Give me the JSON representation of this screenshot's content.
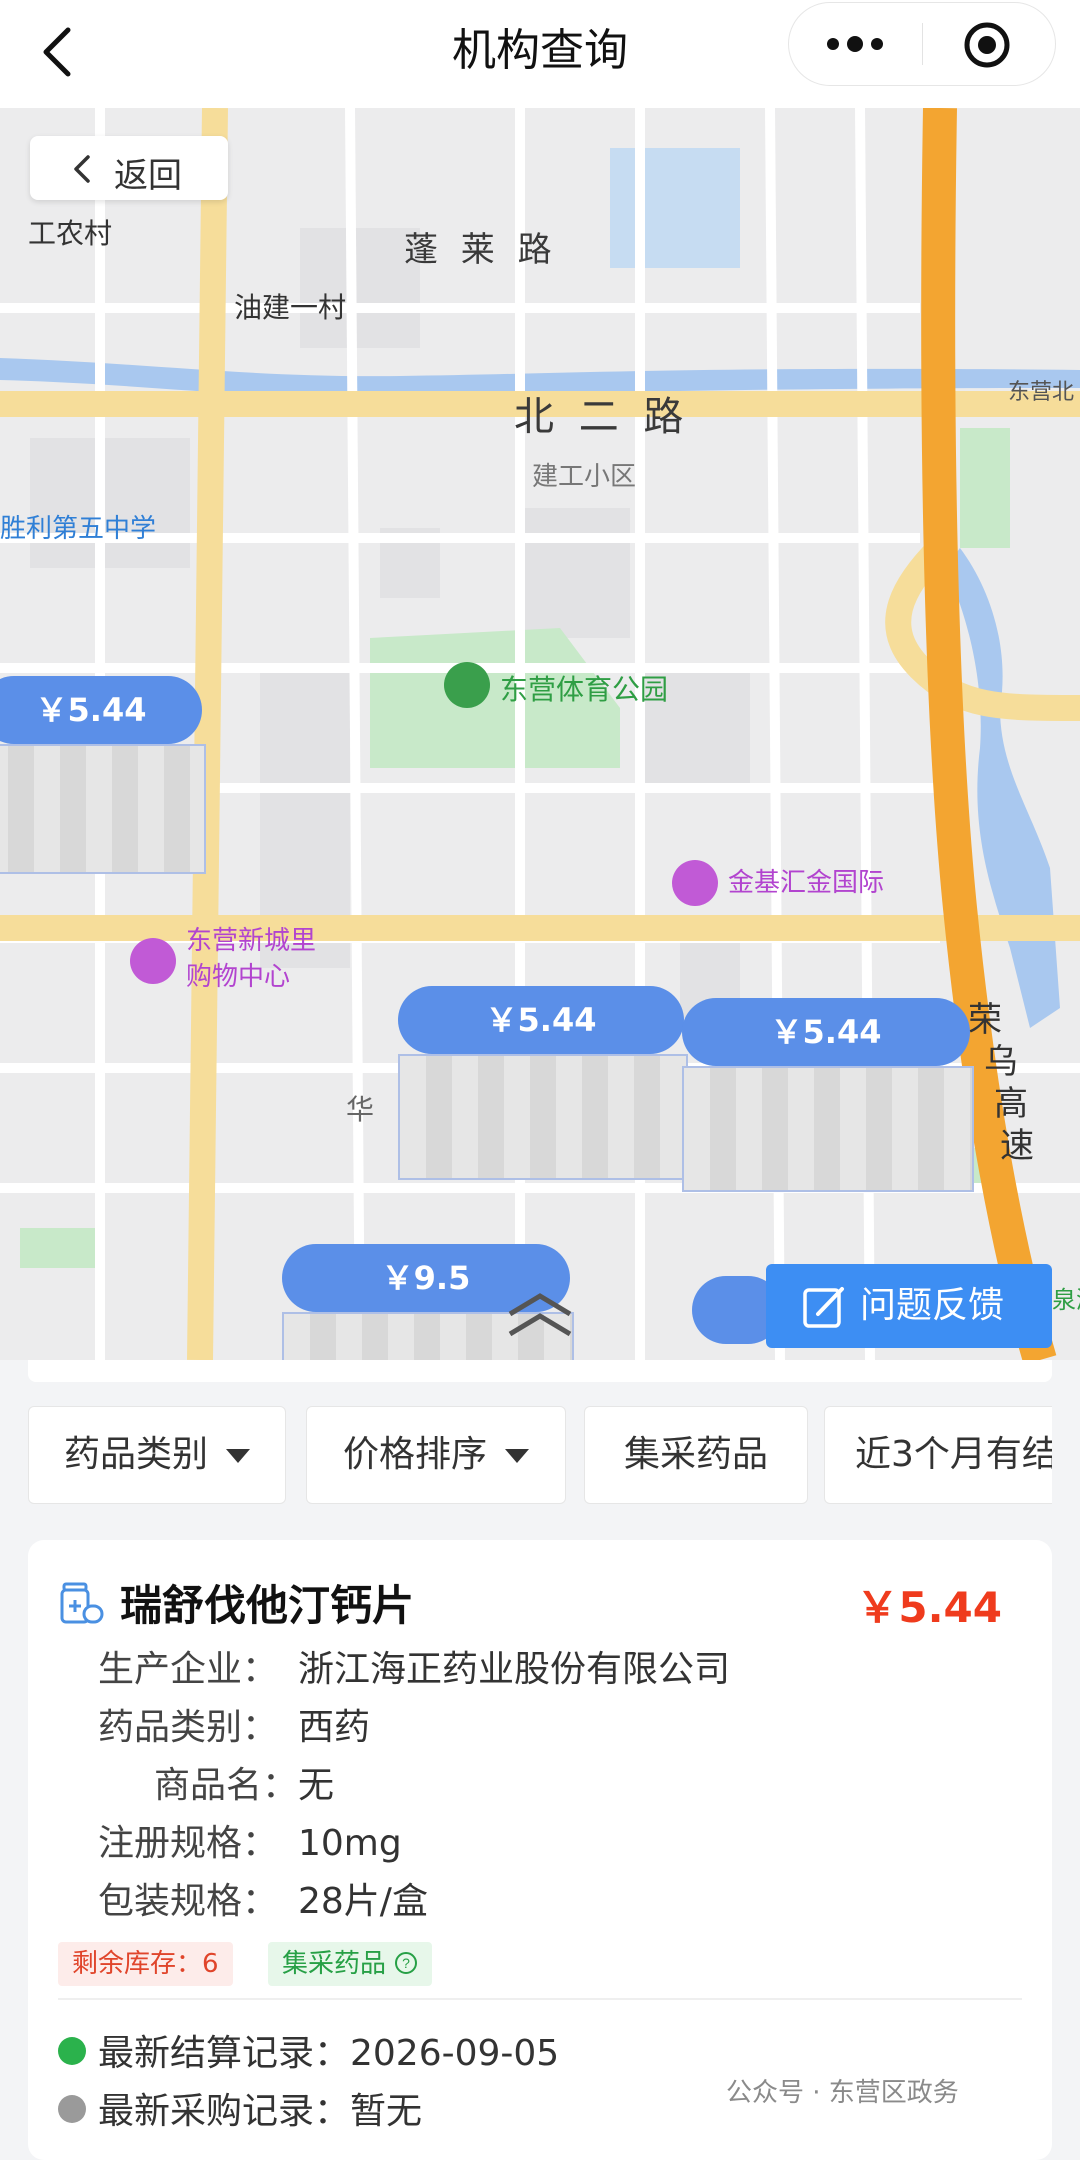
{
  "nav": {
    "title": "机构查询"
  },
  "map": {
    "back_label": "返回",
    "labels": {
      "gongnongcun": "工农村",
      "penglai_road": "蓬 莱 路",
      "youjian": "油建一村",
      "beier_road": "北 二 路",
      "jiangong": "建工小区",
      "dongying_bei": "东营北",
      "shengli5": "胜利第五中学",
      "sports_park": "东营体育公园",
      "jinji": "金基汇金国际",
      "xincheng_1": "东营新城里",
      "xincheng_2": "购物中心",
      "rongwu_1": "荣",
      "rongwu_2": "乌",
      "rongwu_3": "高",
      "rongwu_4": "速",
      "hua": "华",
      "quan": "泉游"
    },
    "markers": [
      {
        "price": "￥5.44"
      },
      {
        "price": "￥5.44"
      },
      {
        "price": "￥5.44"
      },
      {
        "price": "￥9.5"
      }
    ],
    "feedback_label": "问题反馈"
  },
  "filters": {
    "category": "药品类别",
    "price_sort": "价格排序",
    "jicai": "集采药品",
    "recent": "近3个月有结"
  },
  "card": {
    "name": "瑞舒伐他汀钙片",
    "price": "￥5.44",
    "fields": [
      {
        "label": "生产企业：",
        "value": "浙江海正药业股份有限公司"
      },
      {
        "label": "药品类别：",
        "value": "西药"
      },
      {
        "label": "商品名：",
        "value": "无"
      },
      {
        "label": "注册规格：",
        "value": "10mg"
      },
      {
        "label": "包装规格：",
        "value": "28片/盒"
      }
    ],
    "stock_tag": "剩余库存：6",
    "jicai_tag": "集采药品",
    "settle_record": "最新结算记录：2026-09-05",
    "purchase_record": "最新采购记录：暂无"
  },
  "watermark": "公众号 · 东营区政务"
}
